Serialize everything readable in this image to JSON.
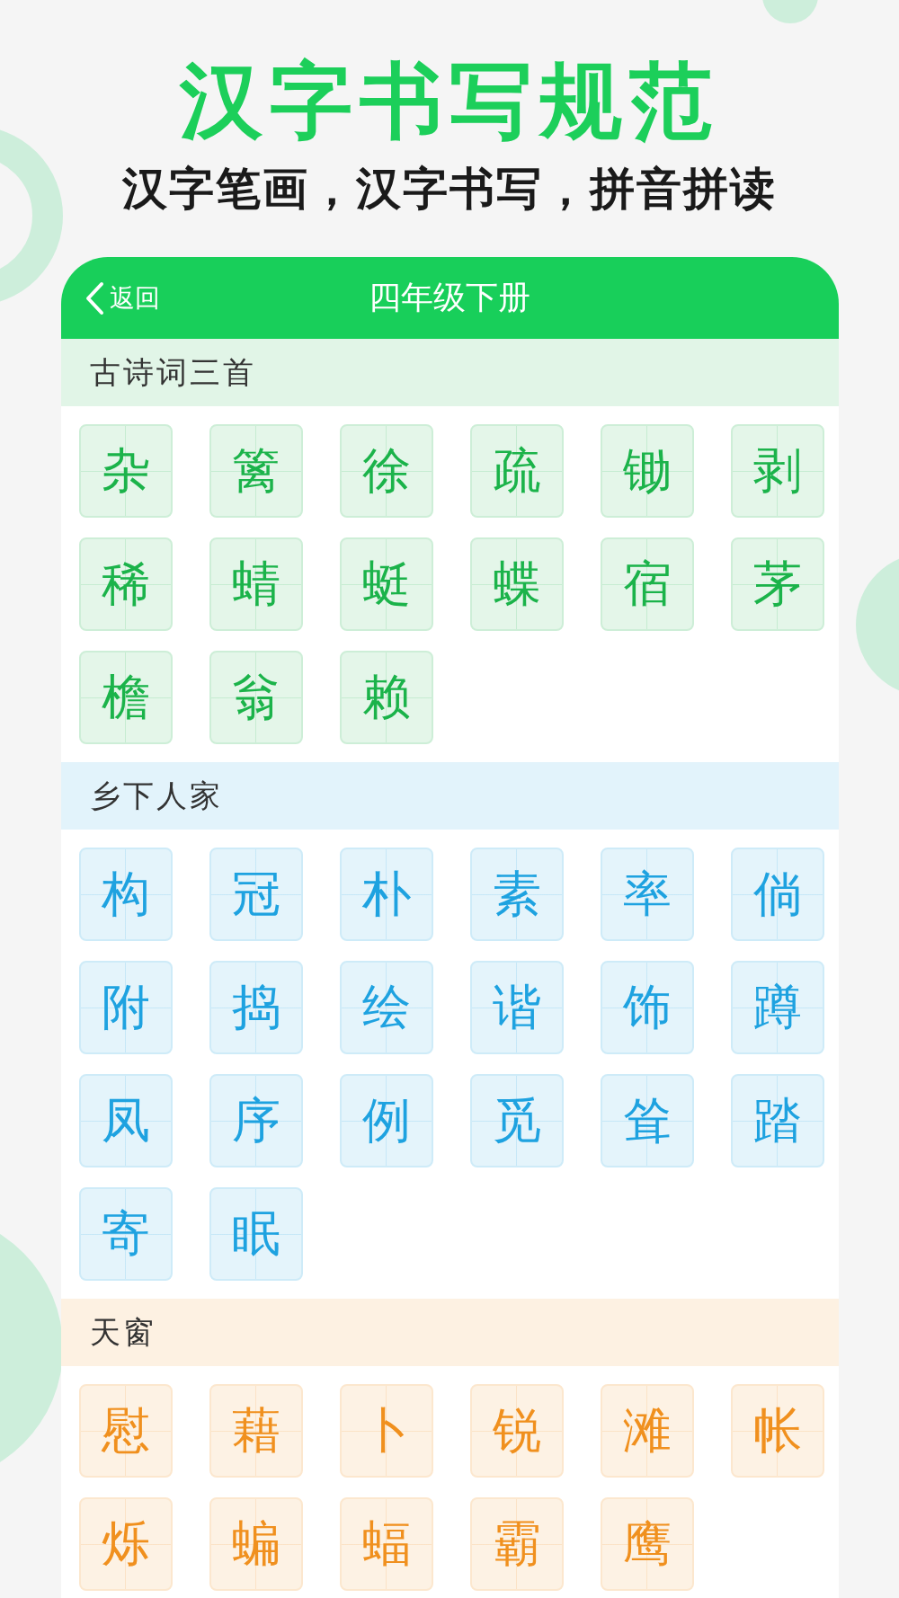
{
  "headline": "汉字书写规范",
  "subheadline": "汉字笔画，汉字书写，拼音拼读",
  "header": {
    "back": "返回",
    "title": "四年级下册"
  },
  "sections": [
    {
      "title": "古诗词三首",
      "color": "#1bb34a",
      "chars": [
        "杂",
        "篱",
        "徐",
        "疏",
        "锄",
        "剥",
        "稀",
        "蜻",
        "蜓",
        "蝶",
        "宿",
        "茅",
        "檐",
        "翁",
        "赖"
      ]
    },
    {
      "title": "乡下人家",
      "color": "#1ea2e0",
      "chars": [
        "构",
        "冠",
        "朴",
        "素",
        "率",
        "倘",
        "附",
        "捣",
        "绘",
        "谐",
        "饰",
        "蹲",
        "凤",
        "序",
        "例",
        "觅",
        "耸",
        "踏",
        "寄",
        "眠"
      ]
    },
    {
      "title": "天窗",
      "color": "#f0901e",
      "chars": [
        "慰",
        "藉",
        "卜",
        "锐",
        "滩",
        "帐",
        "烁",
        "蝙",
        "蝠",
        "霸",
        "鹰"
      ]
    }
  ]
}
